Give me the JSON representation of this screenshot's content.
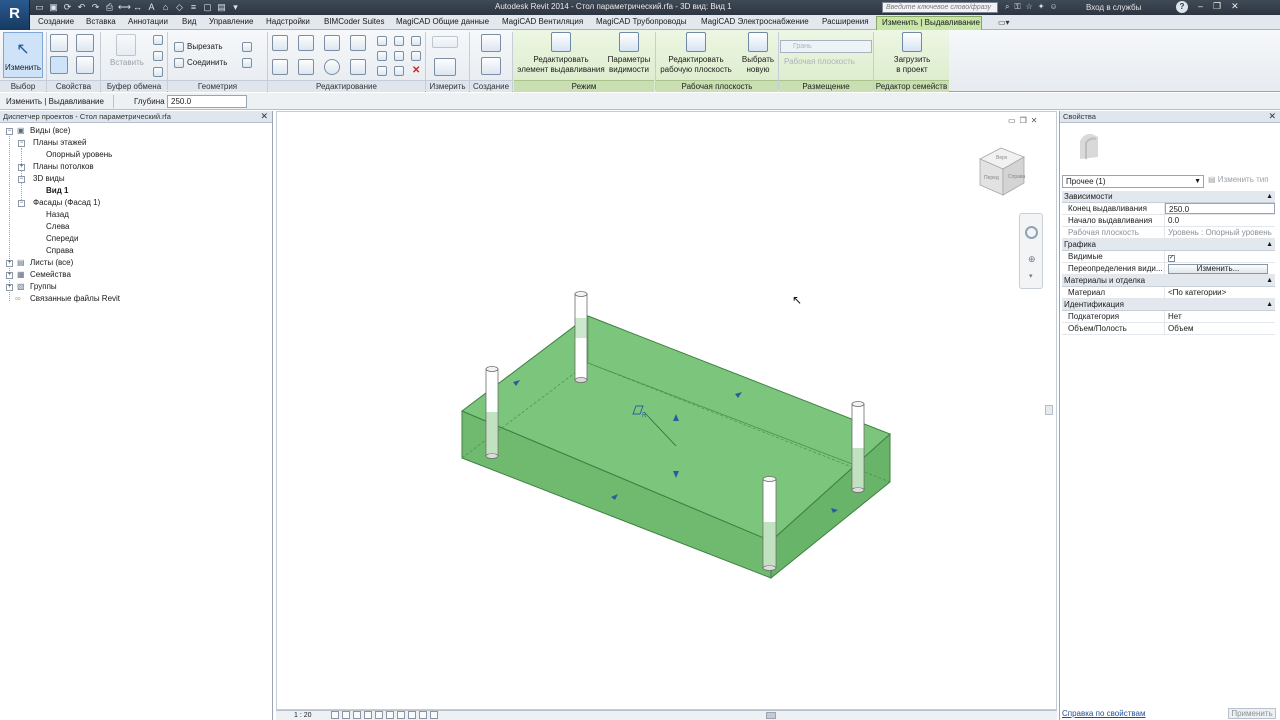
{
  "app": {
    "logo_letter": "R",
    "window_title": "Autodesk Revit 2014  -  Стол параметрический.rfa - 3D вид: Вид 1",
    "search_placeholder": "Введите ключевое слово/фразу",
    "signin_label": "Вход в службы"
  },
  "tabs": [
    "Создание",
    "Вставка",
    "Аннотации",
    "Вид",
    "Управление",
    "Надстройки",
    "BIMCoder Suites",
    "MagiCAD Общие данные",
    "MagiCAD Вентиляция",
    "MagiCAD Трубопроводы",
    "MagiCAD Электроснабжение",
    "Расширения"
  ],
  "active_tab": "Изменить | Выдавливание",
  "ribbon": {
    "modify_label": "Изменить",
    "paste_label": "Вставить",
    "cut_label": "Вырезать",
    "join_label": "Соединить",
    "groups": {
      "select": "Выбор",
      "properties": "Свойства",
      "clipboard": "Буфер обмена",
      "geometry": "Геометрия",
      "edit": "Редактирование",
      "measure": "Измерить",
      "create": "Создание",
      "mode": "Режим",
      "workplane": "Рабочая плоскость",
      "placement": "Размещение",
      "family_editor": "Редактор семейств"
    },
    "buttons": {
      "edit_extrusion": [
        "Редактировать",
        "элемент выдавливания"
      ],
      "visibility": [
        "Параметры",
        "видимости"
      ],
      "edit_workplane": [
        "Редактировать",
        "рабочую плоскость"
      ],
      "pick_new": [
        "Выбрать",
        "новую"
      ],
      "face": "Грань",
      "workplane_dim": "Рабочая плоскость",
      "load_into_project": [
        "Загрузить",
        "в проект"
      ]
    }
  },
  "options_bar": {
    "context": "Изменить | Выдавливание",
    "depth_label": "Глубина",
    "depth_value": "250.0"
  },
  "browser": {
    "title": "Диспетчер проектов - Стол параметрический.rfa",
    "items": [
      "Виды (все)",
      "Планы этажей",
      "Опорный уровень",
      "Планы потолков",
      "3D виды",
      "Вид 1",
      "Фасады (Фасад 1)",
      "Назад",
      "Слева",
      "Спереди",
      "Справа",
      "Листы (все)",
      "Семейства",
      "Группы",
      "Связанные файлы Revit"
    ]
  },
  "viewcube": {
    "top": "Верх",
    "front": "Перед",
    "right": "Справа"
  },
  "view_bar": {
    "scale": "1 : 20"
  },
  "properties": {
    "title": "Свойства",
    "type_selector": "Прочее (1)",
    "edit_type": "Изменить тип",
    "categories": {
      "constraints": "Зависимости",
      "graphics": "Графика",
      "materials": "Материалы и отделка",
      "identity": "Идентификация"
    },
    "rows": {
      "extrusion_end": {
        "name": "Конец выдавливания",
        "value": "250.0"
      },
      "extrusion_start": {
        "name": "Начало выдавливания",
        "value": "0.0"
      },
      "work_plane": {
        "name": "Рабочая плоскость",
        "value": "Уровень : Опорный уровень"
      },
      "visible": {
        "name": "Видимые",
        "value": "✓"
      },
      "visibility_override": {
        "name": "Переопределения види...",
        "value": "Изменить..."
      },
      "material": {
        "name": "Материал",
        "value": "<По категории>"
      },
      "subcategory": {
        "name": "Подкатегория",
        "value": "Нет"
      },
      "solid_void": {
        "name": "Объем/Полость",
        "value": "Объем"
      }
    },
    "help_link": "Справка по свойствам",
    "apply_button": "Применить"
  },
  "colors": {
    "extrusion_fill": "#79c27a",
    "extrusion_edge": "#3f7f41",
    "active_tab": "#c7e6a8"
  }
}
